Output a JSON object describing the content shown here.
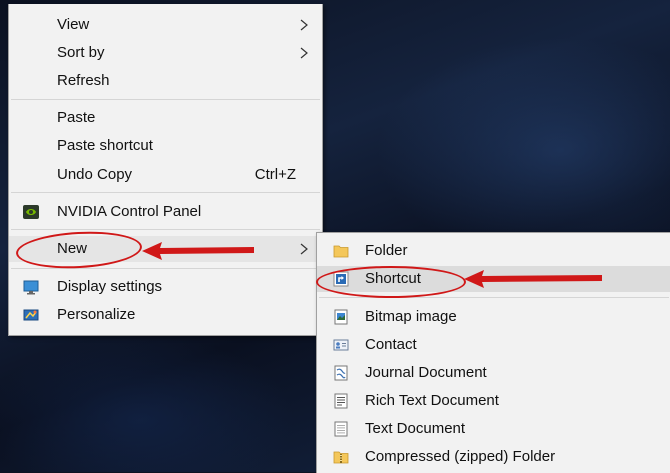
{
  "desktop": {
    "context_menu": {
      "items": [
        {
          "label": "View",
          "submenu": true
        },
        {
          "label": "Sort by",
          "submenu": true
        },
        {
          "label": "Refresh"
        },
        {
          "label": "Paste"
        },
        {
          "label": "Paste shortcut"
        },
        {
          "label": "Undo Copy",
          "shortcut": "Ctrl+Z"
        },
        {
          "label": "NVIDIA Control Panel",
          "icon": "nvidia-icon"
        },
        {
          "label": "New",
          "submenu": true,
          "state": "highlighted"
        },
        {
          "label": "Display settings",
          "icon": "display-icon"
        },
        {
          "label": "Personalize",
          "icon": "personalize-icon"
        }
      ]
    },
    "new_submenu": {
      "items": [
        {
          "label": "Folder",
          "icon": "folder-icon"
        },
        {
          "label": "Shortcut",
          "icon": "shortcut-icon",
          "state": "highlighted"
        },
        {
          "label": "Bitmap image",
          "icon": "bitmap-icon"
        },
        {
          "label": "Contact",
          "icon": "contact-icon"
        },
        {
          "label": "Journal Document",
          "icon": "journal-icon"
        },
        {
          "label": "Rich Text Document",
          "icon": "rtf-icon"
        },
        {
          "label": "Text Document",
          "icon": "text-document-icon"
        },
        {
          "label": "Compressed (zipped) Folder",
          "icon": "zip-folder-icon"
        }
      ]
    },
    "annotations": {
      "color": "#d01818"
    }
  }
}
